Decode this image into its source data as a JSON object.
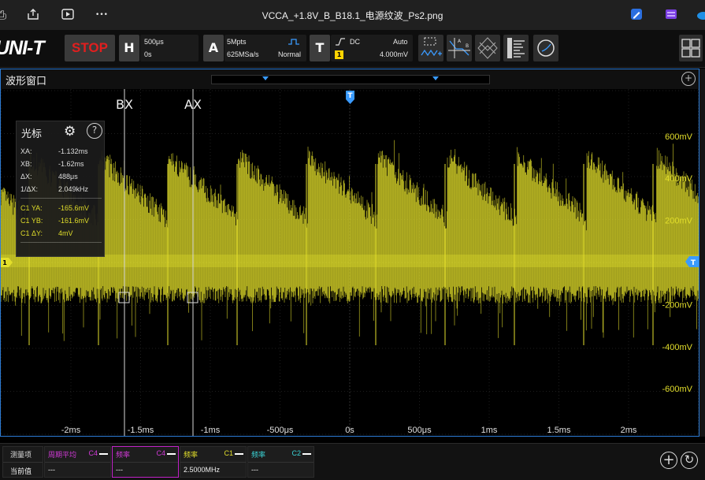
{
  "viewer": {
    "title": "VCCA_+1.8V_B_B18.1_电源纹波_Ps2.png",
    "icons": [
      "print-icon",
      "share-icon",
      "slideshow-icon",
      "more-icon",
      "edit-icon",
      "clipchamp-icon",
      "onedrive-icon"
    ],
    "more_glyph": "•••"
  },
  "toolbar": {
    "logo": "UNI-T",
    "stop_label": "STOP",
    "horizontal": {
      "key": "H",
      "timebase": "500μs",
      "offset": "0s"
    },
    "acquire": {
      "key": "A",
      "depth": "5Mpts",
      "rate": "625MSa/s",
      "mode": "Normal"
    },
    "trigger": {
      "key": "T",
      "coupling": "DC",
      "sweep": "Auto",
      "source": "1",
      "level": "4.000mV"
    }
  },
  "window": {
    "title": "波形窗口",
    "zoom_glyph": "+"
  },
  "plot": {
    "cursor_labels": {
      "bx": "BX",
      "ax": "AX"
    },
    "trigger_marker": "T",
    "channel_marker": "1",
    "y_ticks": [
      "600mV",
      "400mV",
      "200mV",
      "-200mV",
      "-400mV",
      "-600mV"
    ],
    "x_ticks": [
      "-2ms",
      "-1.5ms",
      "-1ms",
      "-500μs",
      "0s",
      "500μs",
      "1ms",
      "1.5ms",
      "2ms"
    ],
    "trace_color": "#e3df2b"
  },
  "cursor_panel": {
    "title": "光标",
    "help_glyph": "?",
    "rows": [
      {
        "label": "XA:",
        "value": "-1.132ms"
      },
      {
        "label": "XB:",
        "value": "-1.62ms"
      },
      {
        "label": "ΔX:",
        "value": "488μs"
      },
      {
        "label": "1/ΔX:",
        "value": "2.049kHz"
      }
    ],
    "channel_rows": [
      {
        "label": "C1 YA:",
        "value": "-165.6mV"
      },
      {
        "label": "C1 YB:",
        "value": "-161.6mV"
      },
      {
        "label": "C1 ΔY:",
        "value": "4mV"
      }
    ]
  },
  "measurements": {
    "header_label": "测量项",
    "value_label": "当前值",
    "items": [
      {
        "name": "周期平均",
        "channel": "C4",
        "value": "---",
        "color": "#d23ad8"
      },
      {
        "name": "频率",
        "channel": "C4",
        "value": "---",
        "color": "#d23ad8"
      },
      {
        "name": "频率",
        "channel": "C1",
        "value": "2.5000MHz",
        "color": "#e3df2b"
      },
      {
        "name": "频率",
        "channel": "C2",
        "value": "---",
        "color": "#3ad3d6"
      }
    ],
    "add_glyph": "+",
    "refresh_glyph": "↻"
  }
}
